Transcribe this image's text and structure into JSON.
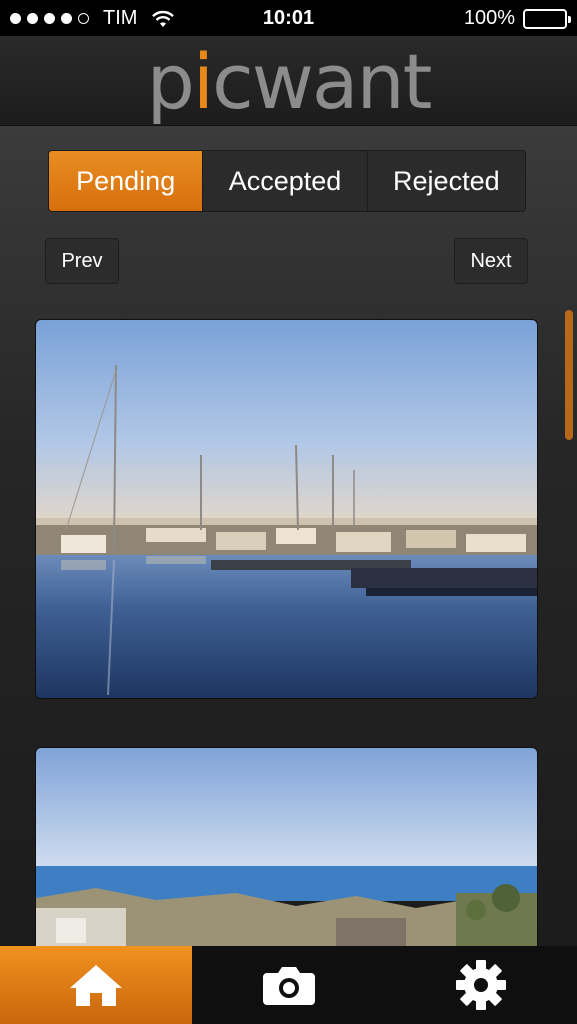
{
  "status_bar": {
    "signal_dots": 5,
    "signal_filled": 4,
    "carrier": "TIM",
    "time": "10:01",
    "battery_label": "100%",
    "battery_level": 1.0
  },
  "header": {
    "logo": "picwant"
  },
  "segments": {
    "items": [
      {
        "label": "Pending",
        "active": true
      },
      {
        "label": "Accepted",
        "active": false
      },
      {
        "label": "Rejected",
        "active": false
      }
    ]
  },
  "pager": {
    "prev_label": "Prev",
    "next_label": "Next"
  },
  "photos": [
    {
      "subject": "marina with sailboats at dusk"
    },
    {
      "subject": "coastal town overlooking the sea"
    }
  ],
  "tab_bar": {
    "items": [
      {
        "icon": "home-icon",
        "active": true
      },
      {
        "icon": "camera-icon",
        "active": false
      },
      {
        "icon": "gear-icon",
        "active": false
      }
    ]
  },
  "colors": {
    "accent": "#e8891c",
    "background": "#262626"
  }
}
